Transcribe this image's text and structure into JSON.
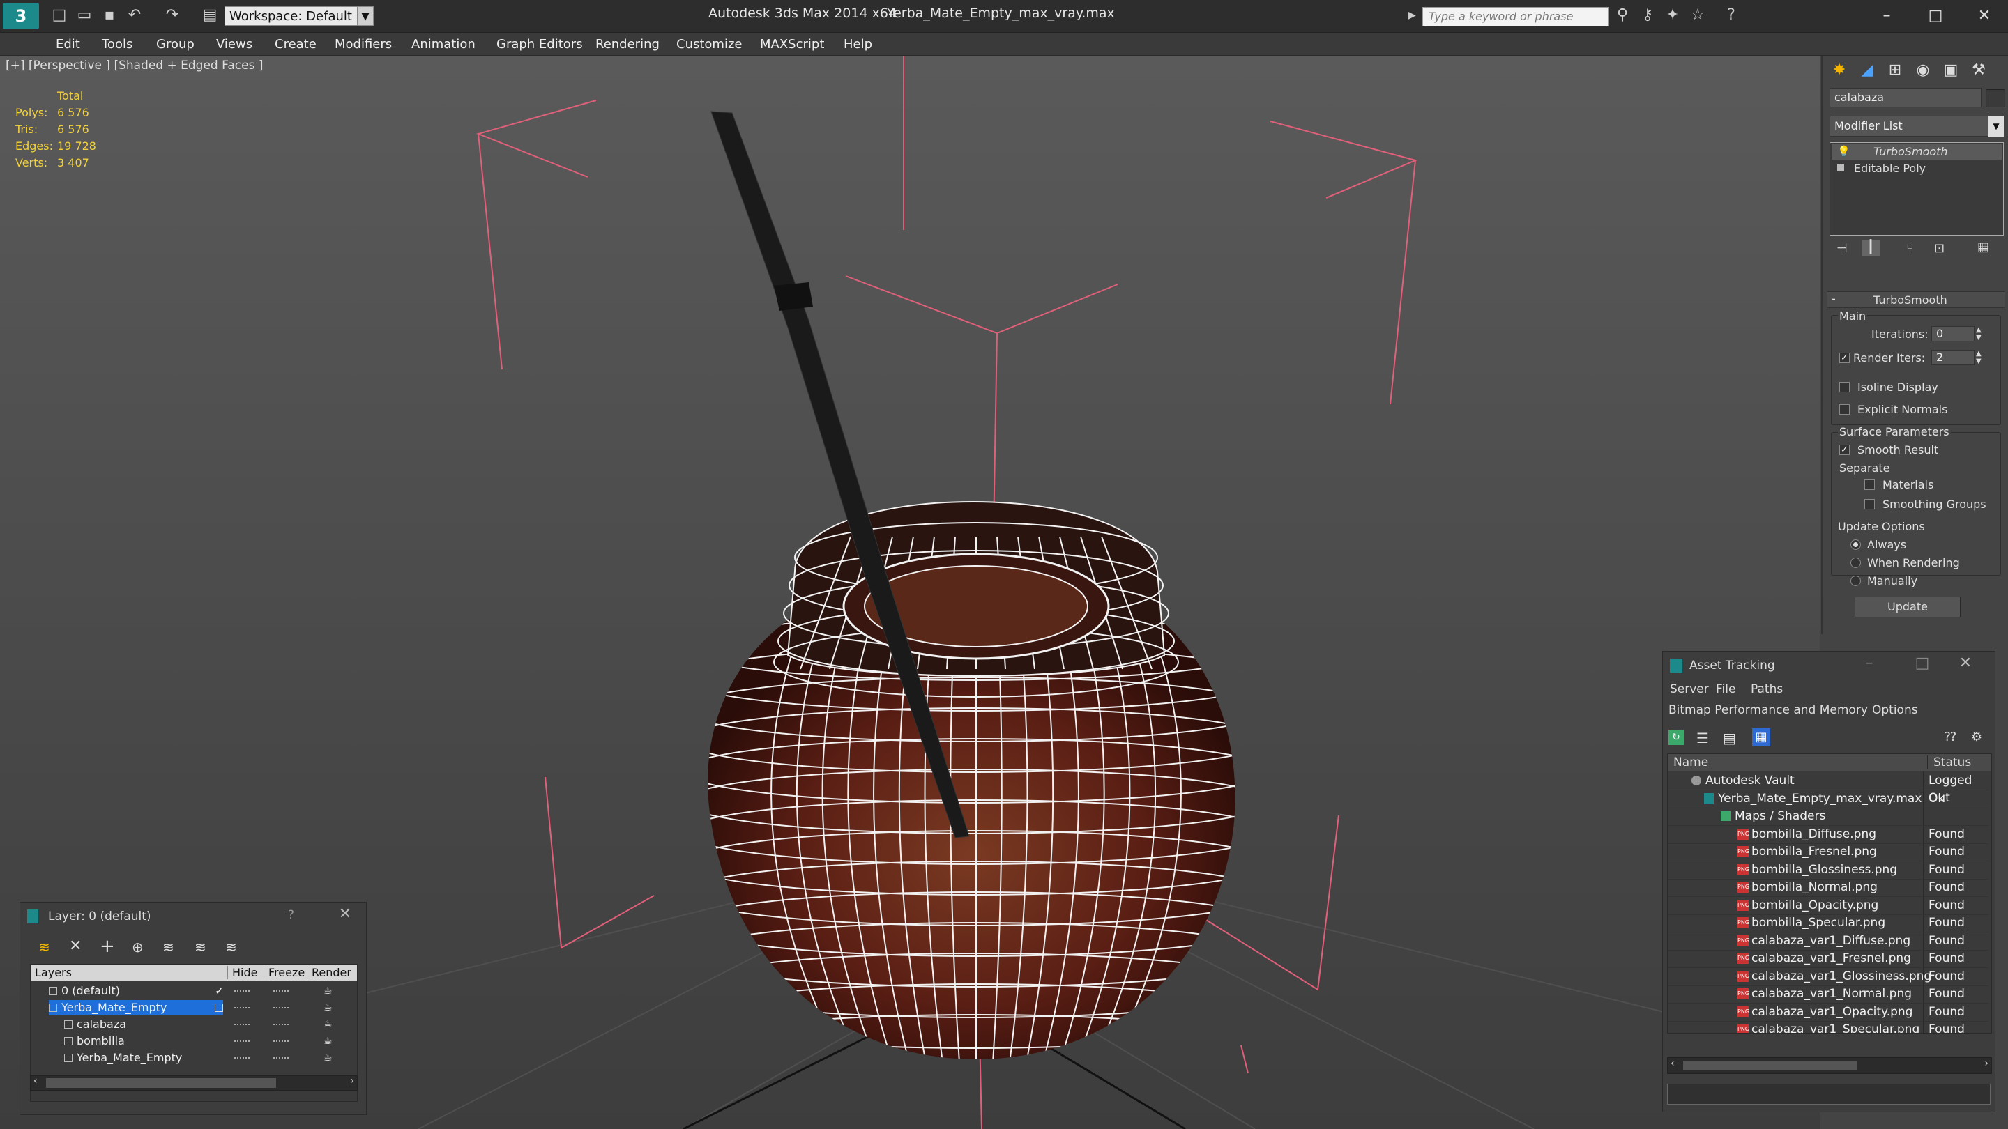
{
  "titlebar": {
    "app_title": "Autodesk 3ds Max  2014 x64",
    "file_title": "Yerba_Mate_Empty_max_vray.max",
    "workspace": "Workspace: Default",
    "search_placeholder": "Type a keyword or phrase"
  },
  "menu": [
    "Edit",
    "Tools",
    "Group",
    "Views",
    "Create",
    "Modifiers",
    "Animation",
    "Graph Editors",
    "Rendering",
    "Customize",
    "MAXScript",
    "Help"
  ],
  "viewport": {
    "label": "[+] [Perspective ] [Shaded + Edged Faces ]",
    "stats": {
      "header": "Total",
      "rows": [
        {
          "label": "Polys:",
          "value": "6 576"
        },
        {
          "label": "Tris:",
          "value": "6 576"
        },
        {
          "label": "Edges:",
          "value": "19 728"
        },
        {
          "label": "Verts:",
          "value": "3 407"
        }
      ]
    }
  },
  "command_panel": {
    "object_name": "calabaza",
    "modifier_list": "Modifier List",
    "stack": [
      "TurboSmooth",
      "Editable Poly"
    ],
    "rollout_title": "TurboSmooth",
    "main_label": "Main",
    "iterations_label": "Iterations:",
    "iterations_value": "0",
    "render_iters_label": "Render Iters:",
    "render_iters_value": "2",
    "isoline_display": "Isoline Display",
    "explicit_normals": "Explicit Normals",
    "surface_parameters": "Surface Parameters",
    "smooth_result": "Smooth Result",
    "separate": "Separate",
    "materials": "Materials",
    "smoothing_groups": "Smoothing Groups",
    "update_options": "Update Options",
    "always": "Always",
    "when_rendering": "When Rendering",
    "manually": "Manually",
    "update_button": "Update"
  },
  "asset_tracking": {
    "title": "Asset Tracking",
    "menu1": [
      "Server",
      "File",
      "Paths"
    ],
    "menu2": [
      "Bitmap Performance and Memory",
      "Options"
    ],
    "col_name": "Name",
    "col_status": "Status",
    "rows": [
      {
        "name": "Autodesk Vault",
        "status": "Logged Out"
      },
      {
        "name": "Yerba_Mate_Empty_max_vray.max",
        "status": "Ok"
      },
      {
        "name": "Maps / Shaders",
        "status": ""
      },
      {
        "name": "bombilla_Diffuse.png",
        "status": "Found"
      },
      {
        "name": "bombilla_Fresnel.png",
        "status": "Found"
      },
      {
        "name": "bombilla_Glossiness.png",
        "status": "Found"
      },
      {
        "name": "bombilla_Normal.png",
        "status": "Found"
      },
      {
        "name": "bombilla_Opacity.png",
        "status": "Found"
      },
      {
        "name": "bombilla_Specular.png",
        "status": "Found"
      },
      {
        "name": "calabaza_var1_Diffuse.png",
        "status": "Found"
      },
      {
        "name": "calabaza_var1_Fresnel.png",
        "status": "Found"
      },
      {
        "name": "calabaza_var1_Glossiness.png",
        "status": "Found"
      },
      {
        "name": "calabaza_var1_Normal.png",
        "status": "Found"
      },
      {
        "name": "calabaza_var1_Opacity.png",
        "status": "Found"
      },
      {
        "name": "calabaza_var1_Specular.png",
        "status": "Found"
      }
    ]
  },
  "layer_dialog": {
    "title": "Layer: 0 (default)",
    "help": "?",
    "columns": [
      "Layers",
      "Hide",
      "Freeze",
      "Render"
    ],
    "rows": [
      "0 (default)",
      "Yerba_Mate_Empty",
      "calabaza",
      "bombilla",
      "Yerba_Mate_Empty"
    ]
  },
  "colors": {
    "accent": "#1e6fd9",
    "stats_text": "#f2d13b",
    "bbox_lines": "#e0607a"
  }
}
